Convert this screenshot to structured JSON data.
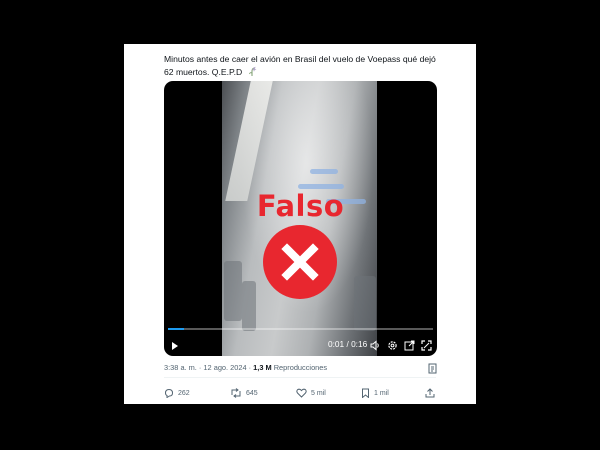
{
  "tweet": {
    "text_line1": "Minutos antes de caer el avión en Brasil del vuelo de Voepass qué dejó",
    "text_line2": "62 muertos. Q.E.P.D",
    "emoji_icon": "wilted-flower-icon"
  },
  "media": {
    "overlay_label": "Falso",
    "overlay_icon": "red-x-icon",
    "time_display": "0:01 / 0:16",
    "progress_fraction": 0.06,
    "controls": [
      "play-icon",
      "volume-icon",
      "settings-icon",
      "popout-icon",
      "fullscreen-icon"
    ]
  },
  "meta": {
    "timestamp": "3:38 a. m. · 12 ago. 2024 · ",
    "views_count": "1,3 M",
    "views_label": " Reproducciones"
  },
  "actions": {
    "replies": "262",
    "reposts": "645",
    "likes": "5 mil",
    "bookmarks": "1 mil"
  },
  "colors": {
    "overlay_red": "#e8272f",
    "progress_blue": "#1d9bf0",
    "secondary_text": "#536471"
  }
}
